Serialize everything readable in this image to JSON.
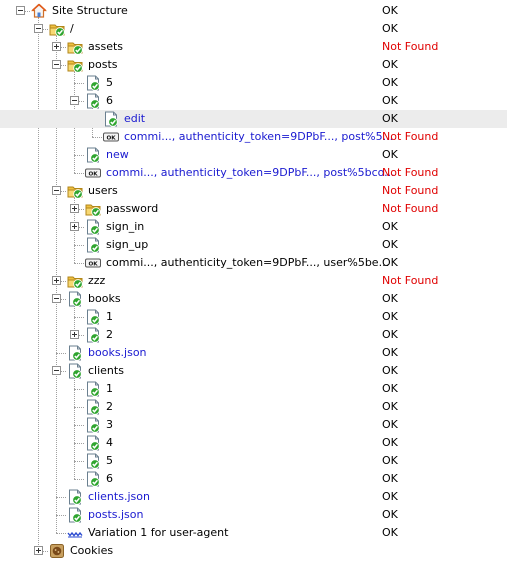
{
  "colors": {
    "ok": "#000000",
    "not_found": "#e00000",
    "link": "#1a1ad0",
    "selected_row": "#ececec",
    "check": "#2fa52f",
    "folder": "#f0c040"
  },
  "tree": {
    "rows": [
      {
        "label": "Site Structure",
        "status": "OK",
        "depth": 0,
        "expander": "minus",
        "icon": "home-icon",
        "kind": "home",
        "blue": false
      },
      {
        "label": "/",
        "status": "OK",
        "depth": 1,
        "expander": "minus",
        "icon": "folder-ok-icon",
        "kind": "folder",
        "blue": false
      },
      {
        "label": "assets",
        "status": "Not Found",
        "depth": 2,
        "expander": "plus",
        "icon": "folder-ok-icon",
        "kind": "folder",
        "blue": false
      },
      {
        "label": "posts",
        "status": "OK",
        "depth": 2,
        "expander": "minus",
        "icon": "folder-ok-icon",
        "kind": "folder",
        "blue": false
      },
      {
        "label": "5",
        "status": "OK",
        "depth": 3,
        "expander": "none",
        "icon": "page-ok-icon",
        "kind": "page",
        "blue": false
      },
      {
        "label": "6",
        "status": "OK",
        "depth": 3,
        "expander": "minus",
        "icon": "page-ok-icon",
        "kind": "page",
        "blue": false
      },
      {
        "label": "edit",
        "status": "OK",
        "depth": 4,
        "expander": "none",
        "icon": "page-ok-icon",
        "kind": "page",
        "blue": true,
        "selected": true
      },
      {
        "label": "commi..., authenticity_token=9DPbF..., post%5...",
        "status": "Not Found",
        "depth": 4,
        "expander": "none",
        "icon": "ok-form-icon",
        "kind": "form",
        "blue": true
      },
      {
        "label": "new",
        "status": "OK",
        "depth": 3,
        "expander": "none",
        "icon": "page-ok-icon",
        "kind": "page",
        "blue": true
      },
      {
        "label": "commi..., authenticity_token=9DPbF..., post%5bco...",
        "status": "Not Found",
        "depth": 3,
        "expander": "none",
        "icon": "ok-form-icon",
        "kind": "form",
        "blue": true
      },
      {
        "label": "users",
        "status": "Not Found",
        "depth": 2,
        "expander": "minus",
        "icon": "folder-ok-icon",
        "kind": "folder",
        "blue": false
      },
      {
        "label": "password",
        "status": "Not Found",
        "depth": 3,
        "expander": "plus",
        "icon": "folder-ok-icon",
        "kind": "folder",
        "blue": false
      },
      {
        "label": "sign_in",
        "status": "OK",
        "depth": 3,
        "expander": "plus",
        "icon": "page-ok-icon",
        "kind": "page",
        "blue": false
      },
      {
        "label": "sign_up",
        "status": "OK",
        "depth": 3,
        "expander": "none",
        "icon": "page-ok-icon",
        "kind": "page",
        "blue": false
      },
      {
        "label": "commi..., authenticity_token=9DPbF..., user%5be...",
        "status": "OK",
        "depth": 3,
        "expander": "none",
        "icon": "ok-form-icon",
        "kind": "form",
        "blue": false
      },
      {
        "label": "zzz",
        "status": "Not Found",
        "depth": 2,
        "expander": "plus",
        "icon": "folder-ok-icon",
        "kind": "folder",
        "blue": false
      },
      {
        "label": "books",
        "status": "OK",
        "depth": 2,
        "expander": "minus",
        "icon": "page-ok-icon",
        "kind": "page",
        "blue": false
      },
      {
        "label": "1",
        "status": "OK",
        "depth": 3,
        "expander": "none",
        "icon": "page-ok-icon",
        "kind": "page",
        "blue": false
      },
      {
        "label": "2",
        "status": "OK",
        "depth": 3,
        "expander": "plus",
        "icon": "page-ok-icon",
        "kind": "page",
        "blue": false
      },
      {
        "label": "books.json",
        "status": "OK",
        "depth": 2,
        "expander": "none",
        "icon": "page-ok-icon",
        "kind": "page",
        "blue": true
      },
      {
        "label": "clients",
        "status": "OK",
        "depth": 2,
        "expander": "minus",
        "icon": "page-ok-icon",
        "kind": "page",
        "blue": false
      },
      {
        "label": "1",
        "status": "OK",
        "depth": 3,
        "expander": "none",
        "icon": "page-ok-icon",
        "kind": "page",
        "blue": false
      },
      {
        "label": "2",
        "status": "OK",
        "depth": 3,
        "expander": "none",
        "icon": "page-ok-icon",
        "kind": "page",
        "blue": false
      },
      {
        "label": "3",
        "status": "OK",
        "depth": 3,
        "expander": "none",
        "icon": "page-ok-icon",
        "kind": "page",
        "blue": false
      },
      {
        "label": "4",
        "status": "OK",
        "depth": 3,
        "expander": "none",
        "icon": "page-ok-icon",
        "kind": "page",
        "blue": false
      },
      {
        "label": "5",
        "status": "OK",
        "depth": 3,
        "expander": "none",
        "icon": "page-ok-icon",
        "kind": "page",
        "blue": false
      },
      {
        "label": "6",
        "status": "OK",
        "depth": 3,
        "expander": "none",
        "icon": "page-ok-icon",
        "kind": "page",
        "blue": false
      },
      {
        "label": "clients.json",
        "status": "OK",
        "depth": 2,
        "expander": "none",
        "icon": "page-ok-icon",
        "kind": "page",
        "blue": true
      },
      {
        "label": "posts.json",
        "status": "OK",
        "depth": 2,
        "expander": "none",
        "icon": "page-ok-icon",
        "kind": "page",
        "blue": true
      },
      {
        "label": "Variation 1 for user-agent",
        "status": "OK",
        "depth": 2,
        "expander": "none",
        "icon": "variation-icon",
        "kind": "variation",
        "blue": false
      },
      {
        "label": "Cookies",
        "status": "",
        "depth": 1,
        "expander": "plus",
        "icon": "cookie-icon",
        "kind": "cookie",
        "blue": false
      }
    ]
  }
}
